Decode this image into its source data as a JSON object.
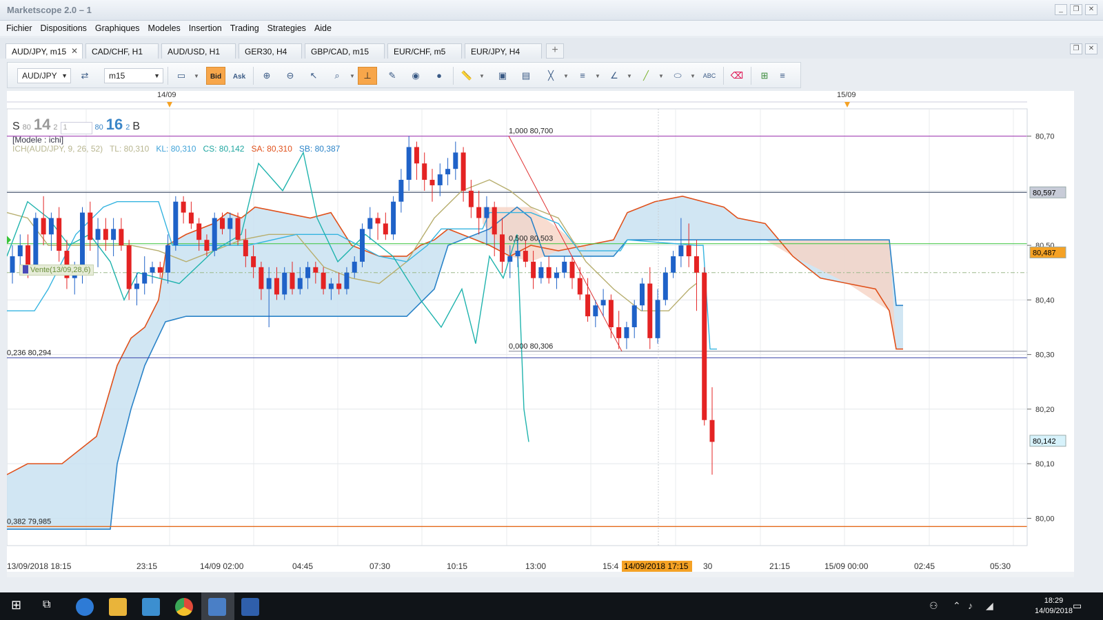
{
  "window": {
    "title": "Marketscope 2.0 – 1"
  },
  "menu": [
    "Fichier",
    "Dispositions",
    "Graphiques",
    "Modeles",
    "Insertion",
    "Trading",
    "Strategies",
    "Aide"
  ],
  "tabs": [
    {
      "label": "AUD/JPY, m15",
      "active": true
    },
    {
      "label": "CAD/CHF, H1"
    },
    {
      "label": "AUD/USD, H1"
    },
    {
      "label": "GER30, H4"
    },
    {
      "label": "GBP/CAD, m15"
    },
    {
      "label": "EUR/CHF, m5"
    },
    {
      "label": "EUR/JPY, H4"
    }
  ],
  "toolbar": {
    "symbol": "AUD/JPY",
    "timeframe": "m15",
    "bid_label": "Bid",
    "ask_label": "Ask"
  },
  "price_panel": {
    "sell_label": "S",
    "sell_prefix": "80",
    "sell_big": "14",
    "sell_sup": "2",
    "quantity": "1",
    "buy_prefix": "80",
    "buy_big": "16",
    "buy_sup": "2",
    "buy_label": "B"
  },
  "chart_info": {
    "model_label": "[Modele : ichi]",
    "ich_label": "ICH(AUD/JPY, 9, 26, 52)",
    "tl": "TL: 80,310",
    "kl": "KL: 80,310",
    "cs": "CS: 80,142",
    "sa": "SA: 80,310",
    "sb": "SB: 80,387",
    "order_label": "Vente(13/09,28,6)"
  },
  "chart_data": {
    "type": "candlestick",
    "title": "",
    "instrument": "AUD/JPY",
    "timeframe": "m15",
    "ylim": [
      79.95,
      80.75
    ],
    "y_ticks": [
      "80,70",
      "80,50",
      "80,40",
      "80,30",
      "80,20",
      "80,10",
      "80,00"
    ],
    "x_ticks": [
      "13/09/2018 18:15",
      "23:15",
      "14/09 02:00",
      "04:45",
      "07:30",
      "10:15",
      "13:00",
      "15:4",
      "30",
      "21:15",
      "15/09 00:00",
      "02:45",
      "05:30"
    ],
    "top_dates": [
      "14/09",
      "15/09"
    ],
    "cursor_time_label": "14/09/2018 17:15",
    "price_labels": [
      {
        "value": 80.597,
        "text": "80,597"
      },
      {
        "value": 80.487,
        "text": "80,487"
      },
      {
        "value": 80.142,
        "text": "80,142"
      }
    ],
    "fibonacci": [
      {
        "text": "1,000 80,700",
        "value": 80.7
      },
      {
        "text": "0,500 80,503",
        "value": 80.503
      },
      {
        "text": "0,000 80,306",
        "value": 80.306
      },
      {
        "text": "0,236 80,294",
        "value": 80.294
      },
      {
        "text": "0,382 79,985",
        "value": 79.985
      }
    ],
    "candles": [
      [
        80.45,
        80.5,
        80.43,
        80.48
      ],
      [
        80.48,
        80.52,
        80.46,
        80.5
      ],
      [
        80.5,
        80.52,
        80.44,
        80.46
      ],
      [
        80.46,
        80.56,
        80.45,
        80.55
      ],
      [
        80.55,
        80.59,
        80.5,
        80.52
      ],
      [
        80.52,
        80.56,
        80.49,
        80.55
      ],
      [
        80.55,
        80.57,
        80.47,
        80.49
      ],
      [
        80.49,
        80.51,
        80.42,
        80.44
      ],
      [
        80.44,
        80.47,
        80.41,
        80.45
      ],
      [
        80.45,
        80.57,
        80.43,
        80.56
      ],
      [
        80.56,
        80.58,
        80.49,
        80.51
      ],
      [
        80.51,
        80.55,
        80.46,
        80.53
      ],
      [
        80.53,
        80.55,
        80.49,
        80.51
      ],
      [
        80.51,
        80.55,
        80.48,
        80.53
      ],
      [
        80.53,
        80.55,
        80.49,
        80.5
      ],
      [
        80.5,
        80.51,
        80.4,
        80.42
      ],
      [
        80.42,
        80.45,
        80.39,
        80.43
      ],
      [
        80.43,
        80.48,
        80.41,
        80.45
      ],
      [
        80.45,
        80.47,
        80.43,
        80.46
      ],
      [
        80.46,
        80.47,
        80.44,
        80.45
      ],
      [
        80.45,
        80.52,
        80.43,
        80.5
      ],
      [
        80.5,
        80.59,
        80.49,
        80.58
      ],
      [
        80.58,
        80.59,
        80.54,
        80.56
      ],
      [
        80.56,
        80.58,
        80.53,
        80.54
      ],
      [
        80.54,
        80.55,
        80.49,
        80.51
      ],
      [
        80.51,
        80.52,
        80.48,
        80.49
      ],
      [
        80.49,
        80.56,
        80.48,
        80.55
      ],
      [
        80.55,
        80.56,
        80.52,
        80.53
      ],
      [
        80.53,
        80.56,
        80.5,
        80.55
      ],
      [
        80.55,
        80.56,
        80.5,
        80.51
      ],
      [
        80.51,
        80.53,
        80.46,
        80.48
      ],
      [
        80.48,
        80.5,
        80.44,
        80.46
      ],
      [
        80.46,
        80.47,
        80.4,
        80.42
      ],
      [
        80.42,
        80.46,
        80.35,
        80.44
      ],
      [
        80.44,
        80.46,
        80.4,
        80.41
      ],
      [
        80.41,
        80.46,
        80.4,
        80.45
      ],
      [
        80.45,
        80.47,
        80.41,
        80.42
      ],
      [
        80.42,
        80.46,
        80.41,
        80.44
      ],
      [
        80.44,
        80.47,
        80.42,
        80.46
      ],
      [
        80.46,
        80.47,
        80.43,
        80.45
      ],
      [
        80.45,
        80.46,
        80.41,
        80.42
      ],
      [
        80.42,
        80.44,
        80.4,
        80.43
      ],
      [
        80.43,
        80.45,
        80.41,
        80.42
      ],
      [
        80.42,
        80.46,
        80.41,
        80.45
      ],
      [
        80.45,
        80.48,
        80.44,
        80.47
      ],
      [
        80.47,
        80.54,
        80.46,
        80.53
      ],
      [
        80.53,
        80.57,
        80.51,
        80.55
      ],
      [
        80.55,
        80.56,
        80.51,
        80.54
      ],
      [
        80.54,
        80.56,
        80.51,
        80.52
      ],
      [
        80.52,
        80.59,
        80.51,
        80.58
      ],
      [
        80.58,
        80.64,
        80.56,
        80.62
      ],
      [
        80.62,
        80.7,
        80.6,
        80.68
      ],
      [
        80.68,
        80.69,
        80.62,
        80.65
      ],
      [
        80.65,
        80.67,
        80.6,
        80.62
      ],
      [
        80.62,
        80.64,
        80.58,
        80.61
      ],
      [
        80.61,
        80.65,
        80.59,
        80.63
      ],
      [
        80.63,
        80.66,
        80.61,
        80.64
      ],
      [
        80.64,
        80.69,
        80.62,
        80.67
      ],
      [
        80.67,
        80.68,
        80.58,
        80.6
      ],
      [
        80.6,
        80.62,
        80.55,
        80.57
      ],
      [
        80.57,
        80.6,
        80.52,
        80.55
      ],
      [
        80.55,
        80.59,
        80.5,
        80.57
      ],
      [
        80.57,
        80.58,
        80.48,
        80.52
      ],
      [
        80.52,
        80.55,
        80.45,
        80.47
      ],
      [
        80.47,
        80.5,
        80.44,
        80.48
      ],
      [
        80.48,
        80.51,
        80.46,
        80.49
      ],
      [
        80.49,
        80.51,
        80.46,
        80.47
      ],
      [
        80.47,
        80.49,
        80.42,
        80.44
      ],
      [
        80.44,
        80.47,
        80.43,
        80.46
      ],
      [
        80.46,
        80.48,
        80.43,
        80.44
      ],
      [
        80.44,
        80.46,
        80.42,
        80.45
      ],
      [
        80.45,
        80.48,
        80.44,
        80.47
      ],
      [
        80.47,
        80.48,
        80.42,
        80.44
      ],
      [
        80.44,
        80.46,
        80.4,
        80.41
      ],
      [
        80.41,
        80.44,
        80.36,
        80.37
      ],
      [
        80.37,
        80.4,
        80.35,
        80.39
      ],
      [
        80.39,
        80.42,
        80.37,
        80.4
      ],
      [
        80.4,
        80.41,
        80.33,
        80.35
      ],
      [
        80.35,
        80.38,
        80.31,
        80.33
      ],
      [
        80.33,
        80.36,
        80.31,
        80.35
      ],
      [
        80.35,
        80.4,
        80.33,
        80.39
      ],
      [
        80.39,
        80.44,
        80.38,
        80.43
      ],
      [
        80.43,
        80.46,
        80.31,
        80.33
      ],
      [
        80.33,
        80.42,
        80.32,
        80.4
      ],
      [
        80.4,
        80.46,
        80.39,
        80.45
      ],
      [
        80.45,
        80.49,
        80.44,
        80.48
      ],
      [
        80.48,
        80.55,
        80.46,
        80.5
      ],
      [
        80.5,
        80.54,
        80.46,
        80.48
      ],
      [
        80.48,
        80.51,
        80.38,
        80.45
      ],
      [
        80.45,
        80.46,
        80.17,
        80.18
      ],
      [
        80.18,
        80.24,
        80.08,
        80.14
      ]
    ]
  },
  "taskbar": {
    "time": "18:29",
    "date": "14/09/2018"
  }
}
